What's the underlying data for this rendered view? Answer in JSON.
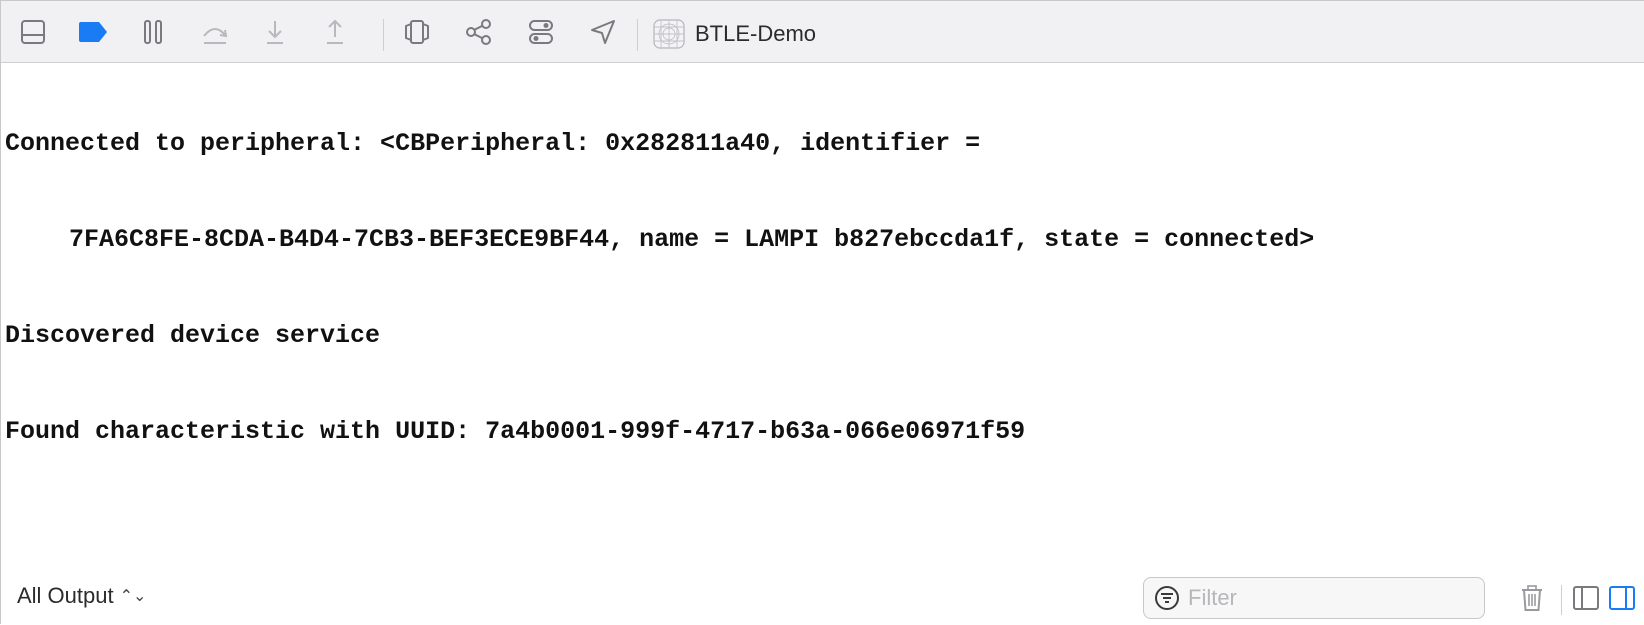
{
  "toolbar": {
    "icons": [
      "toggle-console-panel-icon",
      "breakpoints-toggle-icon",
      "pause-icon",
      "step-over-icon",
      "step-into-icon",
      "step-out-icon",
      "view-hierarchy-icon",
      "memory-graph-icon",
      "environment-overrides-icon",
      "simulate-location-icon"
    ],
    "scheme_label": "BTLE-Demo",
    "accent_color": "#1a7cf5"
  },
  "console": {
    "lines": [
      "Connected to peripheral: <CBPeripheral: 0x282811a40, identifier =",
      "7FA6C8FE-8CDA-B4D4-7CB3-BEF3ECE9BF44, name = LAMPI b827ebccda1f, state = connected>",
      "Discovered device service",
      "Found characteristic with UUID: 7a4b0001-999f-4717-b63a-066e06971f59"
    ]
  },
  "bottom_bar": {
    "scope_label": "All Output",
    "filter_value": "",
    "filter_placeholder": "Filter"
  }
}
